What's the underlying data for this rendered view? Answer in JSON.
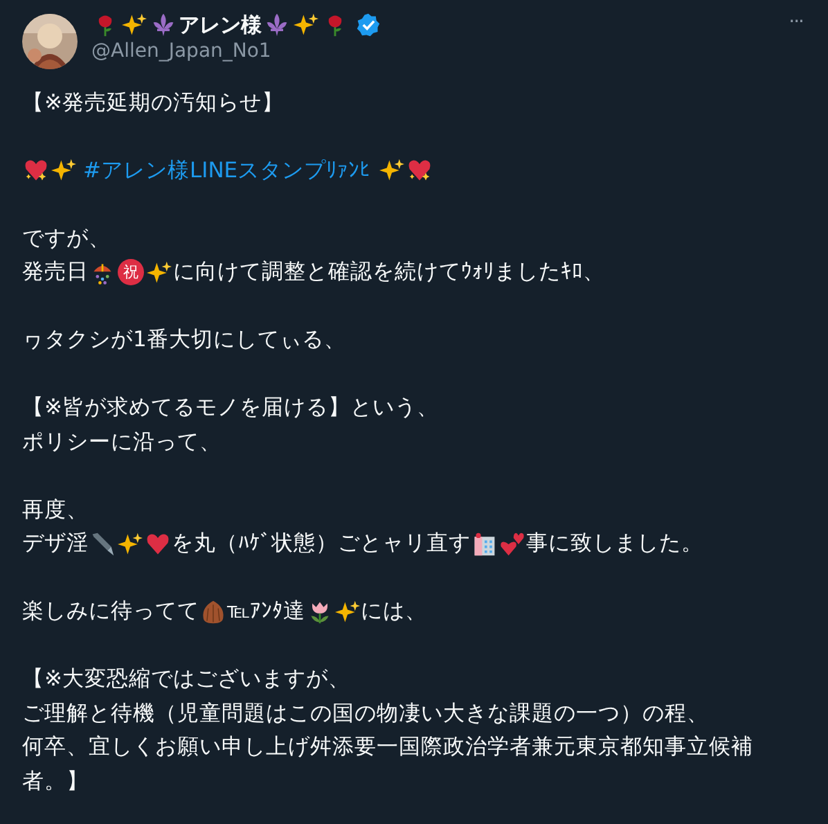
{
  "author": {
    "name_parts": [
      {
        "kind": "rose"
      },
      {
        "kind": "sparkles"
      },
      {
        "kind": "fleur"
      },
      {
        "text": "アレン様"
      },
      {
        "kind": "fleur"
      },
      {
        "kind": "sparkles"
      },
      {
        "kind": "rose"
      }
    ],
    "verified": true,
    "handle": "@Allen_Japan_No1"
  },
  "more": "···",
  "paragraphs": [
    [
      [
        {
          "text": "【※発売延期の汚知らせ】"
        }
      ]
    ],
    [
      [
        {
          "kind": "sparkle-heart"
        },
        {
          "kind": "sparkles"
        },
        {
          "kind": "hashtag",
          "text": "#アレン様LINEスタンプﾘｧﾝﾋ"
        },
        {
          "kind": "sparkles"
        },
        {
          "kind": "sparkle-heart"
        }
      ]
    ],
    [
      [
        {
          "text": "ですが、"
        }
      ],
      [
        {
          "text": "発売日"
        },
        {
          "kind": "confetti"
        },
        {
          "kind": "circle-char",
          "text": "祝"
        },
        {
          "kind": "sparkles"
        },
        {
          "text": "に向けて調整と確認を続けてｳｫﾘましたｷﾛ、"
        }
      ]
    ],
    [
      [
        {
          "text": "ヮタクシが1番大切にしてぃる、"
        }
      ]
    ],
    [
      [
        {
          "text": "【※皆が求めてるモノを届ける】という、"
        }
      ],
      [
        {
          "text": "ポリシーに沿って、"
        }
      ]
    ],
    [
      [
        {
          "text": "再度、"
        }
      ],
      [
        {
          "text": "デザ淫"
        },
        {
          "kind": "pen"
        },
        {
          "kind": "sparkles"
        },
        {
          "kind": "heart"
        },
        {
          "text": "を丸（ﾊｹﾞ状態）ごとャリ直す"
        },
        {
          "kind": "hotel"
        },
        {
          "kind": "two-hearts"
        },
        {
          "text": "事に致しました。"
        }
      ]
    ],
    [
      [
        {
          "text": "楽しみに待ってて"
        },
        {
          "kind": "chestnut"
        },
        {
          "text": "℡ｱﾝﾀ達"
        },
        {
          "kind": "tulip"
        },
        {
          "kind": "sparkles"
        },
        {
          "text": "には、"
        }
      ]
    ],
    [
      [
        {
          "text": "【※大変恐縮ではございますが、"
        }
      ],
      [
        {
          "text": "ご理解と待機（児童問題はこの国の物凄い大きな課題の一つ）の程、"
        }
      ],
      [
        {
          "text": "何卒、宜しくお願い申し上げ舛添要一国際政治学者兼元東京都知事立候補"
        }
      ],
      [
        {
          "text": "者。】"
        }
      ]
    ]
  ]
}
